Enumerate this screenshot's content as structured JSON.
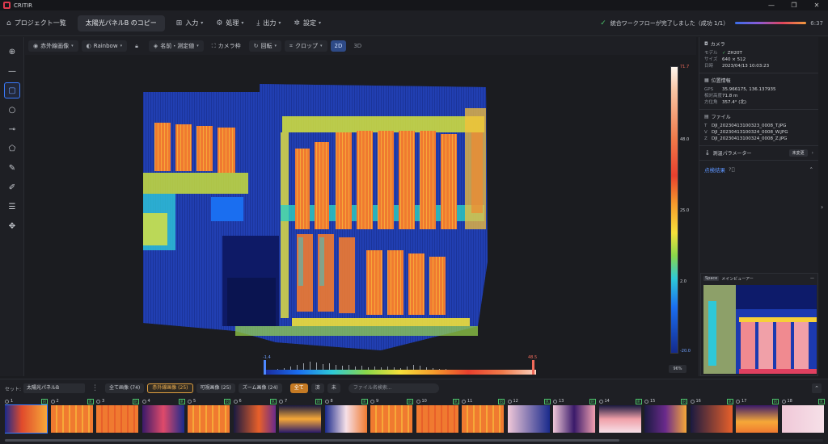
{
  "app": {
    "name": "CRITIR",
    "window_controls": [
      "—",
      "❐",
      "✕"
    ]
  },
  "topbar": {
    "home_label": "プロジェクト一覧",
    "project_tab": "太陽光パネルB のコピー",
    "menus": [
      {
        "label": "入力",
        "icon": "import-icon"
      },
      {
        "label": "処理",
        "icon": "process-icon"
      },
      {
        "label": "出力",
        "icon": "export-icon"
      },
      {
        "label": "設定",
        "icon": "gear-icon"
      }
    ],
    "status_message": "統合ワークフローが完了しました（成功 1/1）",
    "status_time": "6:37"
  },
  "viewbar": {
    "image_type": "赤外線画像",
    "palette": "Rainbow",
    "label_mode": "名前・測定値",
    "camera_frame": "カメラ枠",
    "rotate": "回転",
    "crop": "クロップ",
    "mode_2d": "2D",
    "mode_3d": "3D"
  },
  "colorscale": {
    "max": "71.7",
    "mid_high": "48.0",
    "mid": "25.0",
    "mid_low": "2.0",
    "min": "-20.0",
    "zoom": "96%"
  },
  "histogram": {
    "low": "-1.4",
    "high": "48.5"
  },
  "rightpanel": {
    "camera": {
      "title": "カメラ",
      "model_label": "モデル",
      "model": "ZH20T",
      "size_label": "サイズ",
      "size": "640 × 512",
      "datetime_label": "日時",
      "datetime": "2023/04/13 10:03:23"
    },
    "location": {
      "title": "位置情報",
      "gps_label": "GPS",
      "gps": "35.966175, 136.137935",
      "alt_label": "相対高度",
      "alt": "71.8 m",
      "heading_label": "方位角",
      "heading": "357.4° (北)"
    },
    "files": {
      "title": "ファイル",
      "items": [
        {
          "k": "T",
          "v": "DJI_20230413100323_0008_T.JPG"
        },
        {
          "k": "V",
          "v": "DJI_20230413100324_0008_W.JPG"
        },
        {
          "k": "Z",
          "v": "DJI_20230413100324_0008_Z.JPG"
        }
      ]
    },
    "params": {
      "title": "測温パラメーター",
      "button": "未変更"
    },
    "results": {
      "title": "点検結果"
    }
  },
  "minimap": {
    "key": "Space",
    "label": "メインビューアー",
    "minimize": "—"
  },
  "bottom": {
    "set_label": "セット:",
    "set_value": "太陽光パネルB",
    "filters": [
      {
        "label": "全て画像 (74)",
        "state": "normal"
      },
      {
        "label": "赤外線画像 (25)",
        "state": "active"
      },
      {
        "label": "可視画像 (25)",
        "state": "normal"
      },
      {
        "label": "ズーム画像 (24)",
        "state": "normal"
      }
    ],
    "quick": [
      {
        "label": "全て",
        "state": "orange"
      },
      {
        "label": "済",
        "state": "normal"
      },
      {
        "label": "未",
        "state": "normal"
      }
    ],
    "search_placeholder": "ファイル名検索...",
    "thumbnails": [
      "1",
      "2",
      "3",
      "4",
      "5",
      "6",
      "7",
      "8",
      "9",
      "10",
      "11",
      "12",
      "13",
      "14",
      "15",
      "16",
      "17",
      "18"
    ]
  }
}
